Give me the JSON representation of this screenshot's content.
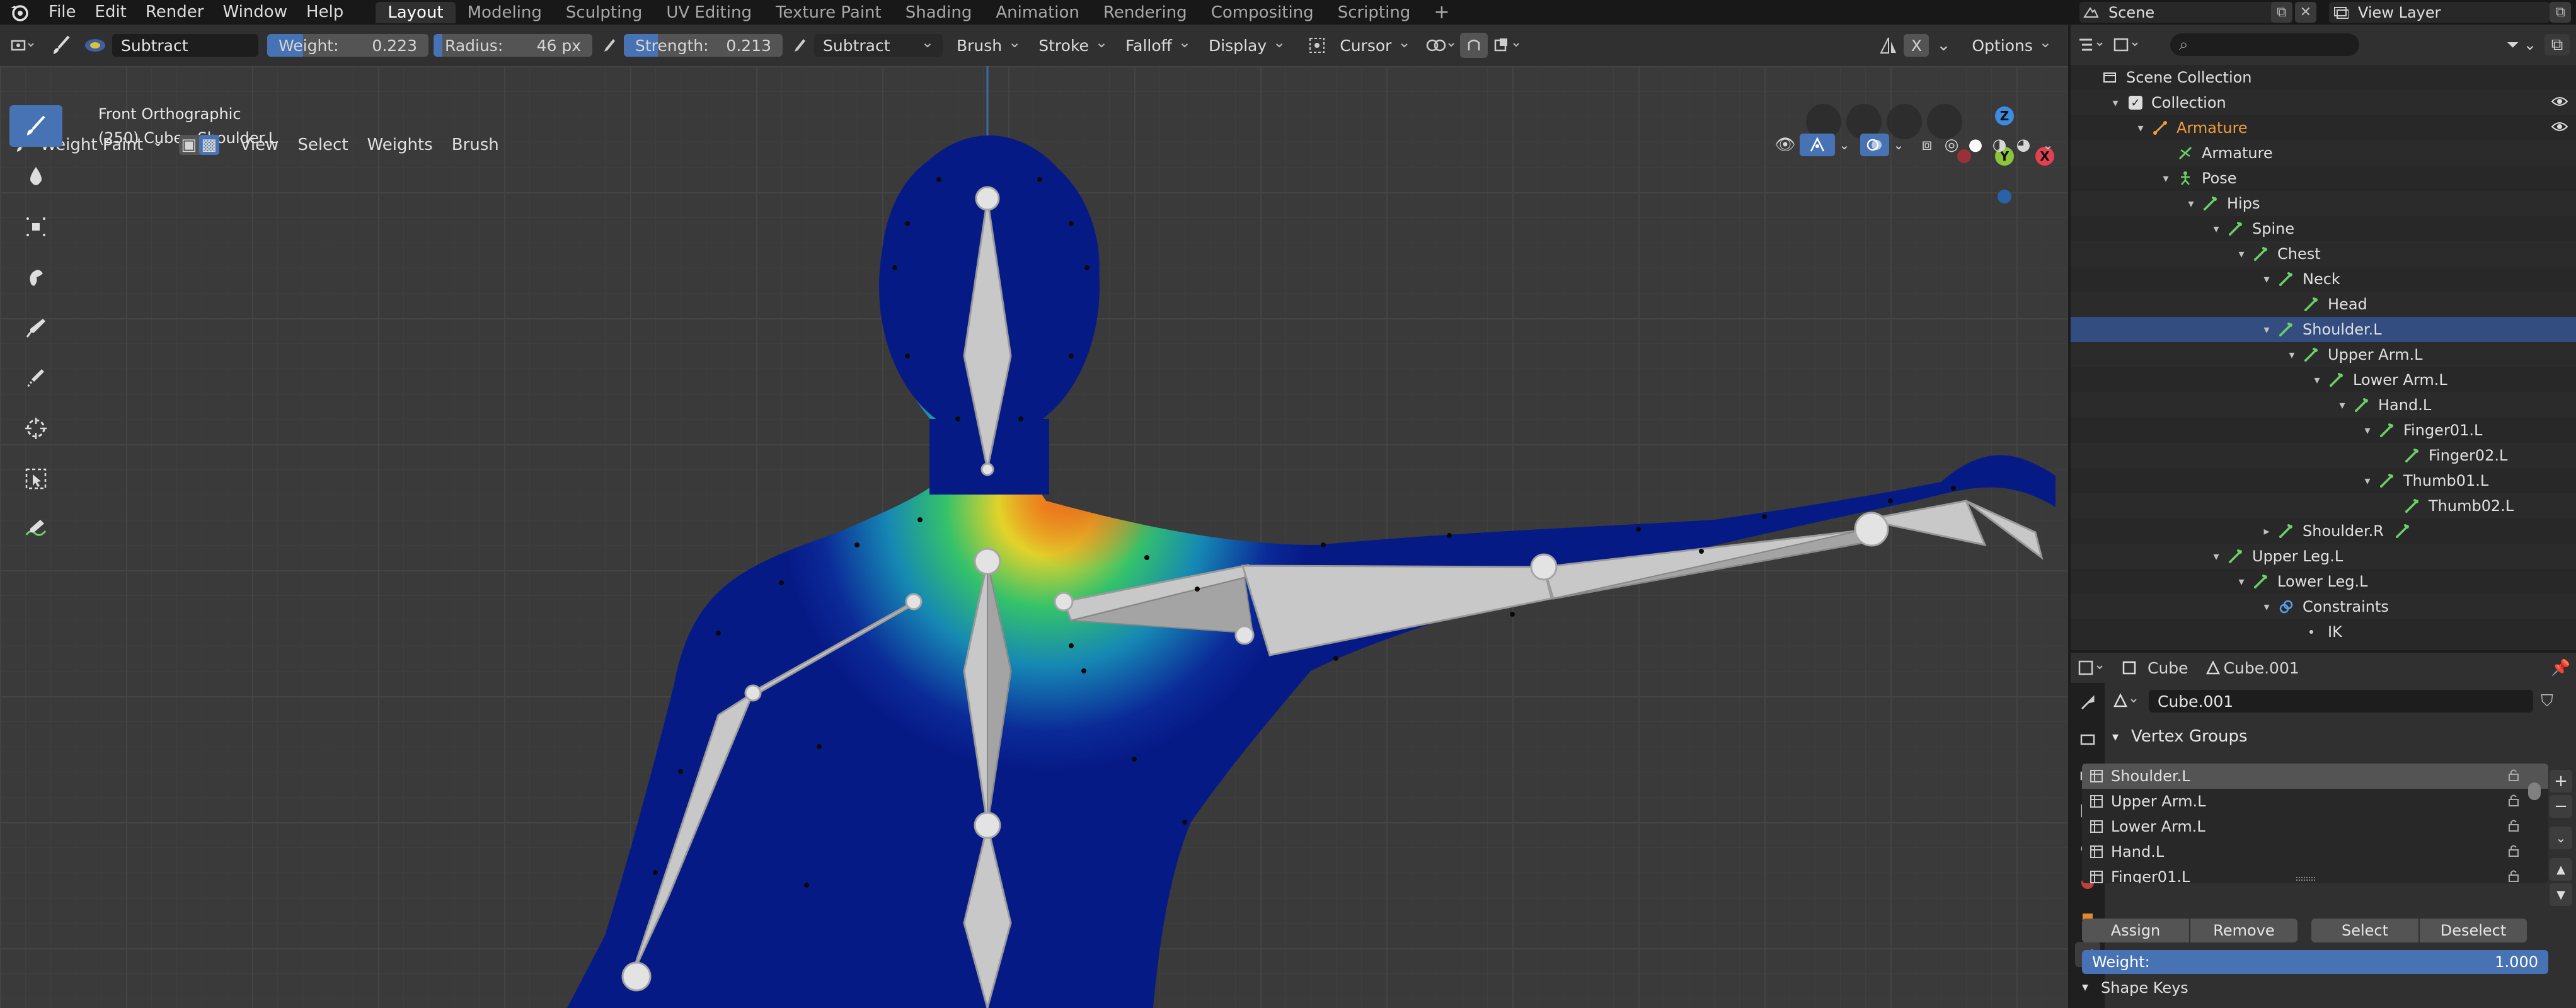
{
  "menubar": {
    "items": [
      "File",
      "Edit",
      "Render",
      "Window",
      "Help"
    ],
    "workspaces": [
      "Layout",
      "Modeling",
      "Sculpting",
      "UV Editing",
      "Texture Paint",
      "Shading",
      "Animation",
      "Rendering",
      "Compositing",
      "Scripting"
    ],
    "active_workspace": "Layout",
    "add_tab": "+",
    "scene": "Scene",
    "view_layer": "View Layer"
  },
  "tool_header": {
    "blend_mode": "Subtract",
    "weight_label": "Weight:",
    "weight_value": "0.223",
    "weight_fraction": 0.223,
    "radius_label": "Radius:",
    "radius_value": "46 px",
    "strength_label": "Strength:",
    "strength_value": "0.213",
    "strength_fraction": 0.213,
    "mode_dropdown": "Subtract",
    "brush": "Brush",
    "stroke": "Stroke",
    "falloff": "Falloff",
    "display": "Display",
    "cursor": "Cursor",
    "x_mirror": "X",
    "options": "Options"
  },
  "viewport_header": {
    "mode": "Weight Paint",
    "menus": [
      "View",
      "Select",
      "Weights",
      "Brush"
    ]
  },
  "viewport": {
    "view_name": "Front Orthographic",
    "object_info": "(250) Cube : Shoulder.L",
    "gizmo": {
      "z": "Z",
      "y": "Y",
      "x": "X"
    }
  },
  "outliner": {
    "rows": [
      {
        "label": "Scene Collection",
        "depth": 0,
        "icon": "scene-collection-icon",
        "arrow": ""
      },
      {
        "label": "Collection",
        "depth": 1,
        "icon": "collection-icon",
        "arrow": "▾"
      },
      {
        "label": "Armature",
        "depth": 2,
        "icon": "armature-object-icon",
        "arrow": "▾",
        "orange": true
      },
      {
        "label": "Armature",
        "depth": 3,
        "icon": "armature-data-icon",
        "arrow": ""
      },
      {
        "label": "Pose",
        "depth": 3,
        "icon": "pose-icon",
        "arrow": "▾"
      },
      {
        "label": "Hips",
        "depth": 4,
        "icon": "bone-icon",
        "arrow": "▾"
      },
      {
        "label": "Spine",
        "depth": 5,
        "icon": "bone-icon",
        "arrow": "▾"
      },
      {
        "label": "Chest",
        "depth": 6,
        "icon": "bone-icon",
        "arrow": "▾"
      },
      {
        "label": "Neck",
        "depth": 7,
        "icon": "bone-icon",
        "arrow": "▾"
      },
      {
        "label": "Head",
        "depth": 8,
        "icon": "bone-icon",
        "arrow": ""
      },
      {
        "label": "Shoulder.L",
        "depth": 7,
        "icon": "bone-icon",
        "arrow": "▾",
        "selected": true
      },
      {
        "label": "Upper Arm.L",
        "depth": 8,
        "icon": "bone-icon",
        "arrow": "▾"
      },
      {
        "label": "Lower Arm.L",
        "depth": 9,
        "icon": "bone-icon",
        "arrow": "▾"
      },
      {
        "label": "Hand.L",
        "depth": 10,
        "icon": "bone-icon",
        "arrow": "▾"
      },
      {
        "label": "Finger01.L",
        "depth": 11,
        "icon": "bone-icon",
        "arrow": "▾"
      },
      {
        "label": "Finger02.L",
        "depth": 12,
        "icon": "bone-icon",
        "arrow": ""
      },
      {
        "label": "Thumb01.L",
        "depth": 11,
        "icon": "bone-icon",
        "arrow": "▾"
      },
      {
        "label": "Thumb02.L",
        "depth": 12,
        "icon": "bone-icon",
        "arrow": ""
      },
      {
        "label": "Shoulder.R",
        "depth": 7,
        "icon": "bone-icon",
        "arrow": "▸",
        "extra_icon": true
      },
      {
        "label": "Upper Leg.L",
        "depth": 5,
        "icon": "bone-icon",
        "arrow": "▾"
      },
      {
        "label": "Lower Leg.L",
        "depth": 6,
        "icon": "bone-icon",
        "arrow": "▾"
      },
      {
        "label": "Constraints",
        "depth": 7,
        "icon": "constraint-icon",
        "arrow": "▾"
      },
      {
        "label": "IK",
        "depth": 8,
        "icon": "dot-icon",
        "arrow": ""
      }
    ]
  },
  "properties": {
    "object": "Cube",
    "mesh": "Cube.001",
    "mesh_field": "Cube.001",
    "panel_title": "Vertex Groups",
    "vertex_groups": [
      "Shoulder.L",
      "Upper Arm.L",
      "Lower Arm.L",
      "Hand.L",
      "Finger01.L"
    ],
    "selected_group": "Shoulder.L",
    "buttons": {
      "assign": "Assign",
      "remove": "Remove",
      "select": "Select",
      "deselect": "Deselect"
    },
    "weight_label": "Weight:",
    "weight_value": "1.000",
    "next_panel": "Shape Keys"
  },
  "colors": {
    "accent": "#4772b3",
    "selected_row": "#334d80",
    "armature_orange": "#f09c3c",
    "gizmo_x": "#e0434f",
    "gizmo_y": "#8cc43c",
    "gizmo_z": "#3d8be0"
  }
}
